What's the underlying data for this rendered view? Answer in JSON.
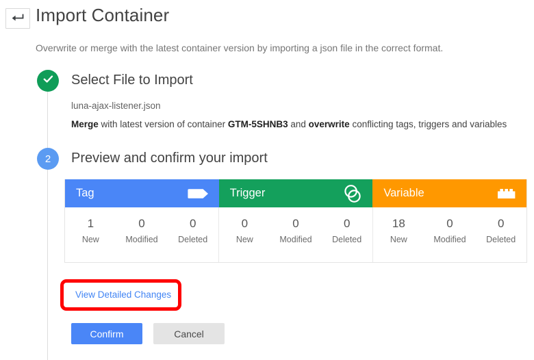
{
  "header": {
    "back_icon": "back-arrow-icon",
    "title": "Import Container"
  },
  "description": "Overwrite or merge with the latest container version by importing a json file in the correct format.",
  "steps": [
    {
      "badge": "check-icon",
      "state": "complete",
      "title": "Select File to Import",
      "file_name": "luna-ajax-listener.json",
      "merge_text": {
        "bold_1": "Merge",
        "mid_1": " with latest version of container ",
        "bold_2": "GTM-5SHNB3",
        "mid_2": " and ",
        "bold_3": "overwrite",
        "mid_3": " conflicting tags, triggers and variables"
      }
    },
    {
      "badge": "2",
      "state": "active",
      "title": "Preview and confirm your import"
    }
  ],
  "summary": {
    "columns": [
      {
        "label": "Tag",
        "icon": "tag-icon",
        "color": "#4a86f7",
        "counts": [
          {
            "value": "1",
            "label": "New"
          },
          {
            "value": "0",
            "label": "Modified"
          },
          {
            "value": "0",
            "label": "Deleted"
          }
        ]
      },
      {
        "label": "Trigger",
        "icon": "trigger-icon",
        "color": "#14a05c",
        "counts": [
          {
            "value": "0",
            "label": "New"
          },
          {
            "value": "0",
            "label": "Modified"
          },
          {
            "value": "0",
            "label": "Deleted"
          }
        ]
      },
      {
        "label": "Variable",
        "icon": "variable-icon",
        "color": "#ff9800",
        "counts": [
          {
            "value": "18",
            "label": "New"
          },
          {
            "value": "0",
            "label": "Modified"
          },
          {
            "value": "0",
            "label": "Deleted"
          }
        ]
      }
    ]
  },
  "detail_link": "View Detailed Changes",
  "annotation": {
    "shape": "rounded-rectangle",
    "color": "#ff0000"
  },
  "actions": {
    "confirm_label": "Confirm",
    "cancel_label": "Cancel"
  }
}
